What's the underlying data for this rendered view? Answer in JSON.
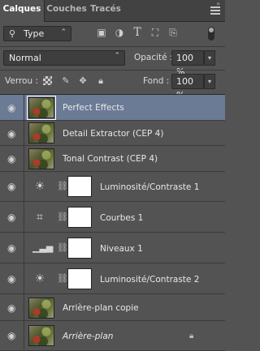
{
  "tabs": [
    {
      "label": "Calques",
      "active": true
    },
    {
      "label": "Couches",
      "active": false
    },
    {
      "label": "Tracés",
      "active": false
    }
  ],
  "collapse_label": "»",
  "filter": {
    "kind_label": "Type",
    "icons": [
      "image-filter-icon",
      "adjustment-filter-icon",
      "type-filter-icon",
      "shape-filter-icon",
      "smart-object-filter-icon"
    ]
  },
  "blend": {
    "mode": "Normal",
    "opacity_label": "Opacité :",
    "opacity_value": "100 %"
  },
  "lock": {
    "label": "Verrou :",
    "fill_label": "Fond :",
    "fill_value": "100 %"
  },
  "layers": [
    {
      "name": "Perfect Effects",
      "type": "image",
      "selected": true,
      "italic": false,
      "locked": false
    },
    {
      "name": "Detail Extractor (CEP 4)",
      "type": "image",
      "selected": false,
      "italic": false,
      "locked": false
    },
    {
      "name": "Tonal Contrast (CEP 4)",
      "type": "image",
      "selected": false,
      "italic": false,
      "locked": false
    },
    {
      "name": "Luminosité/Contraste 1",
      "type": "adjustment",
      "icon": "brightness-contrast-icon",
      "selected": false,
      "italic": false,
      "locked": false
    },
    {
      "name": "Courbes 1",
      "type": "adjustment",
      "icon": "curves-icon",
      "selected": false,
      "italic": false,
      "locked": false
    },
    {
      "name": "Niveaux 1",
      "type": "adjustment",
      "icon": "levels-icon",
      "selected": false,
      "italic": false,
      "locked": false
    },
    {
      "name": "Luminosité/Contraste 2",
      "type": "adjustment",
      "icon": "brightness-contrast-icon",
      "selected": false,
      "italic": false,
      "locked": false
    },
    {
      "name": "Arrière-plan copie",
      "type": "image",
      "selected": false,
      "italic": false,
      "locked": false
    },
    {
      "name": "Arrière-plan",
      "type": "image",
      "selected": false,
      "italic": true,
      "locked": true
    }
  ],
  "colors": {
    "panel": "#535353",
    "selected_row": "#6b7a95",
    "tab_bar": "#424242"
  }
}
